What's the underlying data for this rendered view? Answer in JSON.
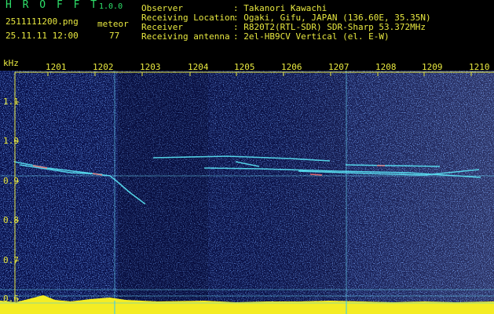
{
  "header": {
    "app_name": "H R O F F T",
    "version": "1.0.0",
    "filename": "2511111200.png",
    "datetime": "25.11.11 12:00",
    "meteor_label": "meteor",
    "meteor_count": "77"
  },
  "info": {
    "observer_label": "Observer",
    "observer_value": ": Takanori Kawachi",
    "location_label": "Receiving Location",
    "location_value": ": Ogaki, Gifu, JAPAN (136.60E, 35.35N)",
    "receiver_label": "Receiver",
    "receiver_value": ": R820T2(RTL-SDR) SDR-Sharp 53.372MHz",
    "antenna_label": "Receiving antenna",
    "antenna_value": ": 2el-HB9CV Vertical (el. E-W)"
  },
  "axis": {
    "unit": "kHz",
    "time_ticks": [
      "1201",
      "1202",
      "1203",
      "1204",
      "1205",
      "1206",
      "1207",
      "1208",
      "1209",
      "1210"
    ],
    "freq_ticks": [
      "1.1",
      "1.0",
      "0.9",
      "0.8",
      "0.7",
      "0.6"
    ]
  },
  "colors": {
    "background": "#08104a",
    "speckle": "#2a5cff",
    "trace": "#5ef0ff",
    "label": "#e8e840",
    "app": "#2ee06a",
    "signal_bar": "#f4ec24",
    "baseline": "#2cc8ff"
  }
}
